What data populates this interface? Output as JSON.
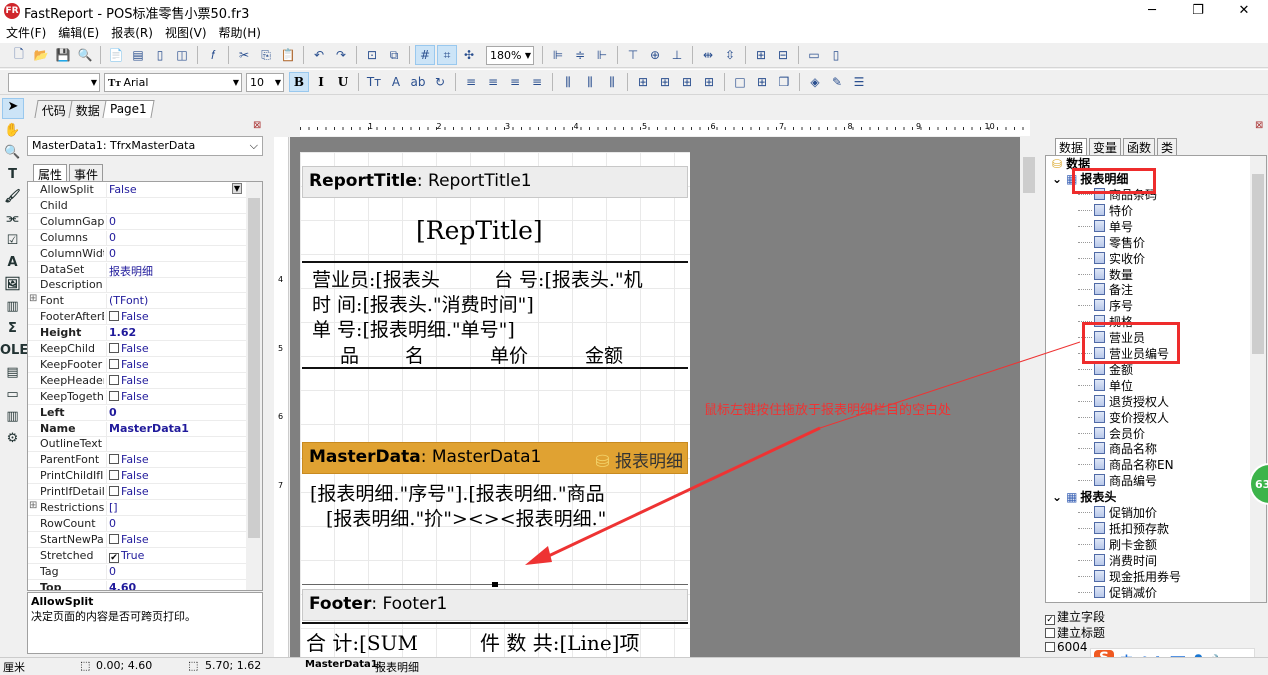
{
  "window": {
    "title": "FastReport - POS标准零售小票50.fr3",
    "controls": [
      "─",
      "❐",
      "✕"
    ]
  },
  "menu": [
    "文件(F)",
    "编辑(E)",
    "报表(R)",
    "视图(V)",
    "帮助(H)"
  ],
  "toolbar1": {
    "icons": [
      "new-icon",
      "open-icon",
      "save-icon",
      "preview-icon",
      "|",
      "new-page-icon",
      "new-dialog-icon",
      "delete-page-icon",
      "page-settings-icon",
      "|",
      "function-icon",
      "|",
      "cut-icon",
      "copy-icon",
      "paste-icon",
      "|",
      "undo-icon",
      "redo-icon",
      "|",
      "group-icon",
      "ungroup-icon",
      "|",
      "grid-icon",
      "align-grid-icon",
      "fit-grid-icon"
    ],
    "zoom": "180%",
    "icons2": [
      "align-left-icon",
      "align-center-icon",
      "align-right-icon",
      "|",
      "align-top-icon",
      "align-middle-icon",
      "align-bottom-icon",
      "|",
      "space-h-icon",
      "space-v-icon",
      "|",
      "center-h-icon",
      "center-v-icon",
      "|",
      "same-width-icon",
      "same-height-icon"
    ]
  },
  "toolbar2": {
    "style": "",
    "font": "Arial",
    "size": "10",
    "format_icons": [
      "bold-icon",
      "italic-icon",
      "underline-icon",
      "|",
      "font-size-icon",
      "font-color-icon",
      "highlight-icon",
      "rotate-icon",
      "|",
      "text-left-icon",
      "text-center-icon",
      "text-right-icon",
      "text-justify-icon",
      "|",
      "text-top-icon",
      "text-vcenter-icon",
      "text-bottom-icon",
      "|",
      "frame-all-icon",
      "frame-top-icon",
      "frame-bottom-icon",
      "frame-left-icon",
      "|",
      "frame-none-icon",
      "frame-right-icon",
      "shadow-icon",
      "|",
      "fill-color-icon",
      "line-color-icon",
      "line-style-icon"
    ]
  },
  "tabs": [
    "代码",
    "数据",
    "Page1"
  ],
  "tools": [
    "select-icon",
    "hand-icon",
    "zoom-icon",
    "text-tool-icon",
    "brush-icon",
    "band-icon",
    "checkbox-icon",
    "text-object-icon",
    "picture-icon",
    "chart-icon",
    "sum-icon",
    "ole-icon",
    "rich-text-icon",
    "shape-icon",
    "barcode-icon",
    "add-objects-icon"
  ],
  "inspector": {
    "object": "MasterData1: TfrxMasterData",
    "tabs": [
      "属性",
      "事件"
    ],
    "props": [
      {
        "name": "AllowSplit",
        "value": "False",
        "dropdown": true
      },
      {
        "name": "Child",
        "value": ""
      },
      {
        "name": "ColumnGap",
        "value": "0"
      },
      {
        "name": "Columns",
        "value": "0"
      },
      {
        "name": "ColumnWidth",
        "value": "0"
      },
      {
        "name": "DataSet",
        "value": "报表明细"
      },
      {
        "name": "Description",
        "value": ""
      },
      {
        "name": "Font",
        "value": "(TFont)",
        "expand": true
      },
      {
        "name": "FooterAfterE",
        "value": "False",
        "check": false
      },
      {
        "name": "Height",
        "value": "1.62",
        "bold": true
      },
      {
        "name": "KeepChild",
        "value": "False",
        "check": false
      },
      {
        "name": "KeepFooter",
        "value": "False",
        "check": false
      },
      {
        "name": "KeepHeader",
        "value": "False",
        "check": false
      },
      {
        "name": "KeepTogethe",
        "value": "False",
        "check": false
      },
      {
        "name": "Left",
        "value": "0",
        "bold": true
      },
      {
        "name": "Name",
        "value": "MasterData1",
        "bold": true
      },
      {
        "name": "OutlineText",
        "value": ""
      },
      {
        "name": "ParentFont",
        "value": "False",
        "check": false
      },
      {
        "name": "PrintChildIfIn",
        "value": "False",
        "check": false
      },
      {
        "name": "PrintIfDetailE",
        "value": "False",
        "check": false
      },
      {
        "name": "Restrictions",
        "value": "[]",
        "expand": true
      },
      {
        "name": "RowCount",
        "value": "0"
      },
      {
        "name": "StartNewPag",
        "value": "False",
        "check": false
      },
      {
        "name": "Stretched",
        "value": "True",
        "check": true
      },
      {
        "name": "Tag",
        "value": "0"
      },
      {
        "name": "Top",
        "value": "4.60",
        "bold": true
      }
    ],
    "desc_title": "AllowSplit",
    "desc_text": "决定页面的内容是否可跨页打印。"
  },
  "ruler_marks": [
    "1",
    "2",
    "3",
    "4",
    "5",
    "6",
    "7",
    "8",
    "9",
    "10"
  ],
  "vruler_marks": [
    "4",
    "5",
    "6",
    "7"
  ],
  "report": {
    "report_title": {
      "type": "ReportTitle",
      "name": ": ReportTitle1"
    },
    "rep_title": "[RepTitle]",
    "line1a": "营业员:[报表头",
    "line1b": "台 号:[报表头.\"机",
    "line2": "时 间:[报表头.\"消费时间\"]",
    "line3": "单 号:[报表明细.\"单号\"]",
    "col_name1": "品",
    "col_name2": "名",
    "col_price": "单价",
    "col_amount": "金额",
    "master": {
      "type": "MasterData",
      "name": ": MasterData1",
      "dataset": "报表明细"
    },
    "md_line1": "[报表明细.\"序号\"].[报表明细.\"商品",
    "md_line2": "[报表明细.\"扴\"><><报表明细.\"",
    "footer": {
      "type": "Footer",
      "name": ": Footer1"
    },
    "ft_a": "合   计:[SUM",
    "ft_b": "件 数 共:[Line]项"
  },
  "annotation": "鼠标左键按住拖放于报表明细栏目的空白处",
  "annotation_color": "#ee3333",
  "right_panel": {
    "tabs": [
      "数据",
      "变量",
      "函数",
      "类"
    ],
    "root": "数据",
    "ds1": "报表明细",
    "ds1_fields": [
      "商品条码",
      "特价",
      "单号",
      "零售价",
      "实收价",
      "数量",
      "备注",
      "序号",
      "规格",
      "营业员",
      "营业员编号",
      "金额",
      "单位",
      "退货授权人",
      "变价授权人",
      "会员价",
      "商品名称",
      "商品名称EN",
      "商品编号"
    ],
    "ds2": "报表头",
    "ds2_fields": [
      "促销加价",
      "抵扣预存款",
      "刷卡金额",
      "消费时间",
      "现金抵用券号",
      "促销减价"
    ],
    "options": [
      {
        "label": "建立字段",
        "checked": true
      },
      {
        "label": "建立标题",
        "checked": false
      },
      {
        "label": "6004",
        "checked": false
      }
    ]
  },
  "badge": "63",
  "ime": {
    "logo": "S",
    "items": [
      "中",
      "☽",
      "°,",
      "⌨",
      "👤",
      "🔧"
    ]
  },
  "status": {
    "unit": "厘米",
    "pos": "0.00; 4.60",
    "size": "5.70; 1.62",
    "sel_name": "MasterData1:",
    "sel_ds": "报表明细"
  }
}
